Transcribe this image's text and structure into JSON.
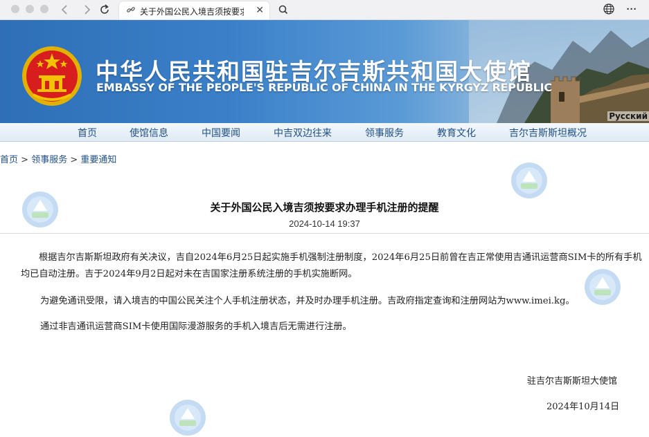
{
  "browser": {
    "tab_title": "关于外国公民入境吉须按要求办理手机注册的提醒",
    "icons": [
      "close-dot-icon",
      "minimize-dot-icon",
      "zoom-dot-icon",
      "back-icon",
      "forward-icon",
      "reload-icon",
      "link-icon",
      "tab-close-icon",
      "search-icon",
      "translate-globe-icon",
      "more-icon"
    ]
  },
  "banner": {
    "cn_name": "中华人民共和国驻吉尔吉斯共和国大使馆",
    "en_name": "EMBASSY OF THE PEOPLE'S REPUBLIC OF CHINA IN THE KYRGYZ REPUBLIC",
    "lang_link": "Русский"
  },
  "nav": {
    "items": [
      "首页",
      "使馆信息",
      "中国要闻",
      "中吉双边往来",
      "领事服务",
      "教育文化",
      "吉尔吉斯斯坦概况"
    ]
  },
  "breadcrumb": {
    "home": "首页",
    "sep1": " > ",
    "section": "领事服务",
    "sep2": " > ",
    "current": "重要通知"
  },
  "article": {
    "title": "关于外国公民入境吉须按要求办理手机注册的提醒",
    "date": "2024-10-14 19:37",
    "paragraphs": [
      "根据吉尔吉斯斯坦政府有关决议，吉自2024年6月25日起实施手机强制注册制度，2024年6月25日前曾在吉正常使用吉通讯运营商SIM卡的所有手机均已自动注册。吉于2024年9月2日起对未在吉国家注册系统注册的手机实施断网。",
      "为避免通讯受限，请入境吉的中国公民关注个人手机注册状态，并及时办理手机注册。吉政府指定查询和注册网站为www.imei.kg。",
      "通过非吉通讯运营商SIM卡使用国际漫游服务的手机入境吉后无需进行注册。"
    ],
    "signature": "驻吉尔吉斯斯坦大使馆",
    "sign_date": "2024年10月14日"
  },
  "colors": {
    "banner_blue": "#3a80c9",
    "nav_text": "#1f4f86",
    "emblem_red": "#d71d1d",
    "emblem_gold": "#f3c200"
  }
}
